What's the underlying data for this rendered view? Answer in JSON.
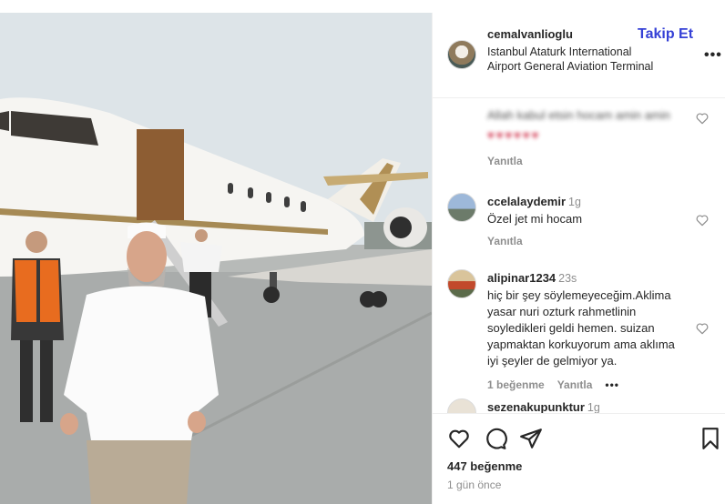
{
  "post": {
    "username": "cemalvanlioglu",
    "location": "Istanbul Ataturk International Airport General Aviation Terminal",
    "follow_label": "Takip Et",
    "more_label": "•••"
  },
  "comments": [
    {
      "username": "",
      "text": "Allah kabul etsin hocam amin amin",
      "emojis": "♥♥♥♥♥♥",
      "reply_label": "Yanıtla"
    },
    {
      "username": "ccelalaydemir",
      "time": "1g",
      "text": "Özel jet mi hocam",
      "reply_label": "Yanıtla"
    },
    {
      "username": "alipinar1234",
      "time": "23s",
      "text": "hiç bir şey söylemeyeceğim.Aklima yasar nuri ozturk rahmetlinin soyledikleri geldi hemen. suizan yapmaktan korkuyorum ama aklıma iyi şeyler de gelmiyor ya.",
      "likes_label": "1 beğenme",
      "reply_label": "Yanıtla",
      "more_label": "•••"
    },
    {
      "username": "sezenakupunktur",
      "time": "1g"
    }
  ],
  "footer": {
    "likes": "447 beğenme",
    "time_ago": "1 gün önce"
  },
  "colors": {
    "follow": "#3540d6",
    "text": "#262626",
    "muted": "#8e8e8e"
  }
}
